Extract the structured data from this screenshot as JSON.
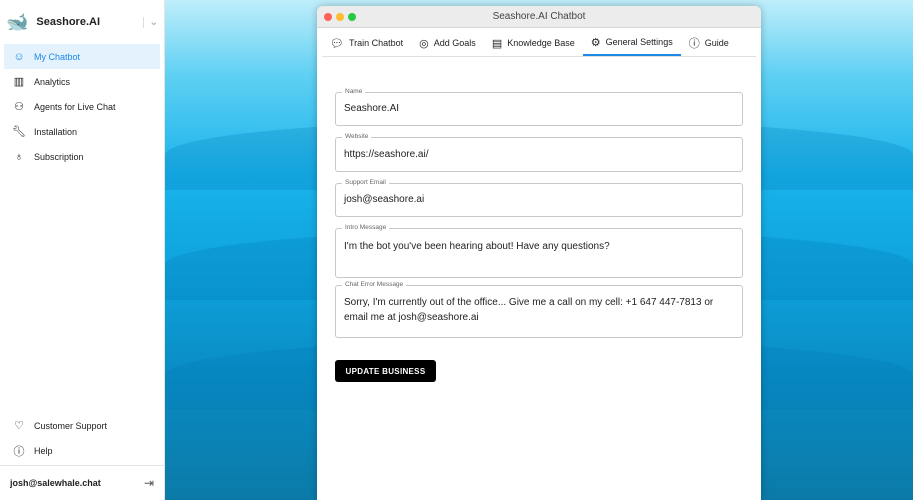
{
  "sidebar": {
    "brand": "Seashore.AI",
    "items": [
      {
        "label": "My Chatbot",
        "icon": "robot-icon"
      },
      {
        "label": "Analytics",
        "icon": "bar-chart-icon"
      },
      {
        "label": "Agents for Live Chat",
        "icon": "users-icon"
      },
      {
        "label": "Installation",
        "icon": "wrench-icon"
      },
      {
        "label": "Subscription",
        "icon": "bag-icon"
      }
    ],
    "bottom_items": [
      {
        "label": "Customer Support",
        "icon": "heart-handshake-icon"
      },
      {
        "label": "Help",
        "icon": "help-icon"
      }
    ],
    "user": "josh@salewhale.chat"
  },
  "window": {
    "title": "Seashore.AI Chatbot",
    "tabs": [
      {
        "label": "Train Chatbot"
      },
      {
        "label": "Add Goals"
      },
      {
        "label": "Knowledge Base"
      },
      {
        "label": "General Settings"
      },
      {
        "label": "Guide"
      }
    ]
  },
  "form": {
    "name": {
      "label": "Name",
      "value": "Seashore.AI"
    },
    "website": {
      "label": "Website",
      "value": "https://seashore.ai/"
    },
    "email": {
      "label": "Support Email",
      "value": "josh@seashore.ai"
    },
    "intro": {
      "label": "Intro Message",
      "value": "I'm the bot you've been hearing about! Have any questions?"
    },
    "error": {
      "label": "Chat Error Message",
      "value": "Sorry, I'm currently out of the office... Give me a call on my cell: +1 647 447-7813 or email me at josh@seashore.ai"
    },
    "button": "UPDATE BUSINESS"
  }
}
